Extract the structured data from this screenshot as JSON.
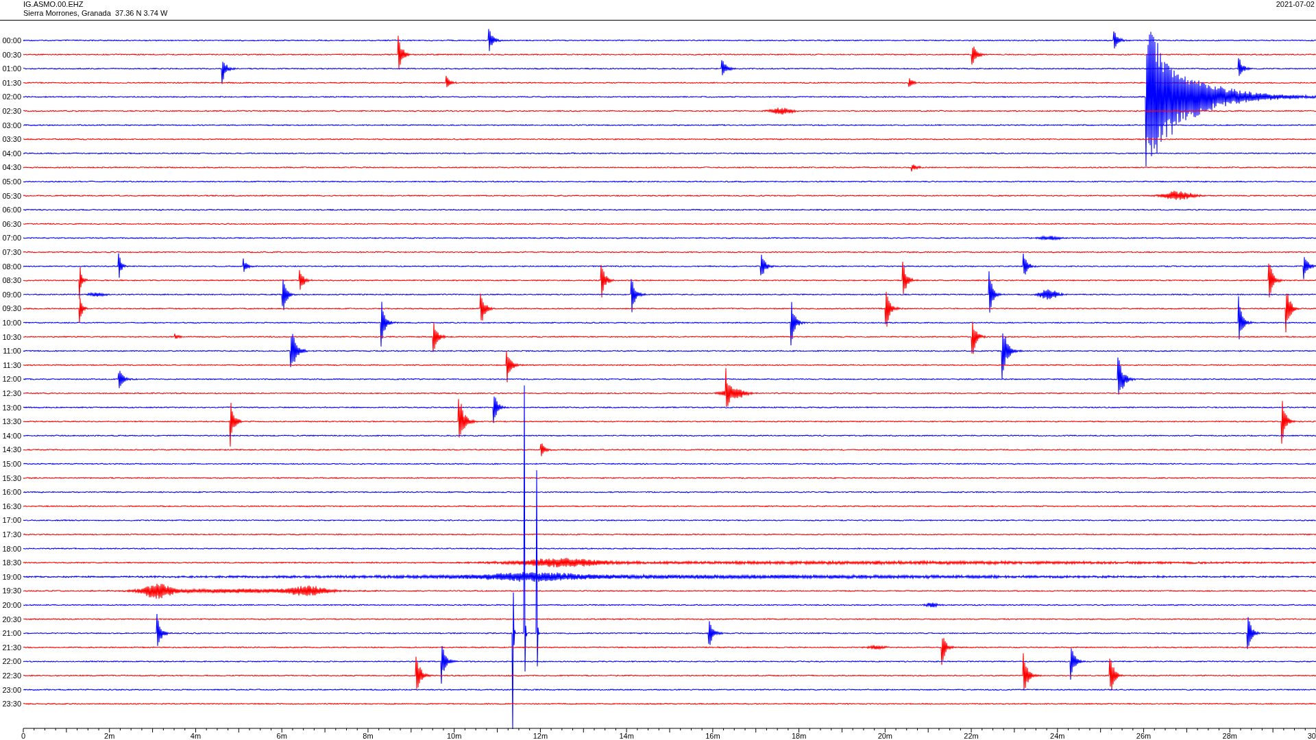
{
  "header": {
    "station": "IG.ASMO.00.EHZ",
    "location": "Sierra Morrones, Granada  37.36 N 3.74 W",
    "date": "2021-07-02"
  },
  "rows": [
    {
      "time": "00:00",
      "color": "#0000ff"
    },
    {
      "time": "00:30",
      "color": "#ff0000"
    },
    {
      "time": "01:00",
      "color": "#0000ff"
    },
    {
      "time": "01:30",
      "color": "#ff0000"
    },
    {
      "time": "02:00",
      "color": "#0000ff"
    },
    {
      "time": "02:30",
      "color": "#ff0000"
    },
    {
      "time": "03:00",
      "color": "#0000ff"
    },
    {
      "time": "03:30",
      "color": "#ff0000"
    },
    {
      "time": "04:00",
      "color": "#0000ff"
    },
    {
      "time": "04:30",
      "color": "#ff0000"
    },
    {
      "time": "05:00",
      "color": "#0000ff"
    },
    {
      "time": "05:30",
      "color": "#ff0000"
    },
    {
      "time": "06:00",
      "color": "#0000ff"
    },
    {
      "time": "06:30",
      "color": "#ff0000"
    },
    {
      "time": "07:00",
      "color": "#0000ff"
    },
    {
      "time": "07:30",
      "color": "#ff0000"
    },
    {
      "time": "08:00",
      "color": "#0000ff"
    },
    {
      "time": "08:30",
      "color": "#ff0000"
    },
    {
      "time": "09:00",
      "color": "#0000ff"
    },
    {
      "time": "09:30",
      "color": "#ff0000"
    },
    {
      "time": "10:00",
      "color": "#0000ff"
    },
    {
      "time": "10:30",
      "color": "#ff0000"
    },
    {
      "time": "11:00",
      "color": "#0000ff"
    },
    {
      "time": "11:30",
      "color": "#ff0000"
    },
    {
      "time": "12:00",
      "color": "#0000ff"
    },
    {
      "time": "12:30",
      "color": "#ff0000"
    },
    {
      "time": "13:00",
      "color": "#0000ff"
    },
    {
      "time": "13:30",
      "color": "#ff0000"
    },
    {
      "time": "14:00",
      "color": "#0000ff"
    },
    {
      "time": "14:30",
      "color": "#ff0000"
    },
    {
      "time": "15:00",
      "color": "#0000ff"
    },
    {
      "time": "15:30",
      "color": "#ff0000"
    },
    {
      "time": "16:00",
      "color": "#0000ff"
    },
    {
      "time": "16:30",
      "color": "#ff0000"
    },
    {
      "time": "17:00",
      "color": "#0000ff"
    },
    {
      "time": "17:30",
      "color": "#ff0000"
    },
    {
      "time": "18:00",
      "color": "#0000ff"
    },
    {
      "time": "18:30",
      "color": "#ff0000"
    },
    {
      "time": "19:00",
      "color": "#0000ff"
    },
    {
      "time": "19:30",
      "color": "#ff0000"
    },
    {
      "time": "20:00",
      "color": "#0000ff"
    },
    {
      "time": "20:30",
      "color": "#ff0000"
    },
    {
      "time": "21:00",
      "color": "#0000ff"
    },
    {
      "time": "21:30",
      "color": "#ff0000"
    },
    {
      "time": "22:00",
      "color": "#0000ff"
    },
    {
      "time": "22:30",
      "color": "#ff0000"
    },
    {
      "time": "23:00",
      "color": "#0000ff"
    },
    {
      "time": "23:30",
      "color": "#ff0000"
    }
  ],
  "x_axis": {
    "ticks": [
      "0",
      "2m",
      "4m",
      "6m",
      "8m",
      "10m",
      "12m",
      "14m",
      "16m",
      "18m",
      "20m",
      "22m",
      "24m",
      "26m",
      "28m",
      "30"
    ]
  }
}
